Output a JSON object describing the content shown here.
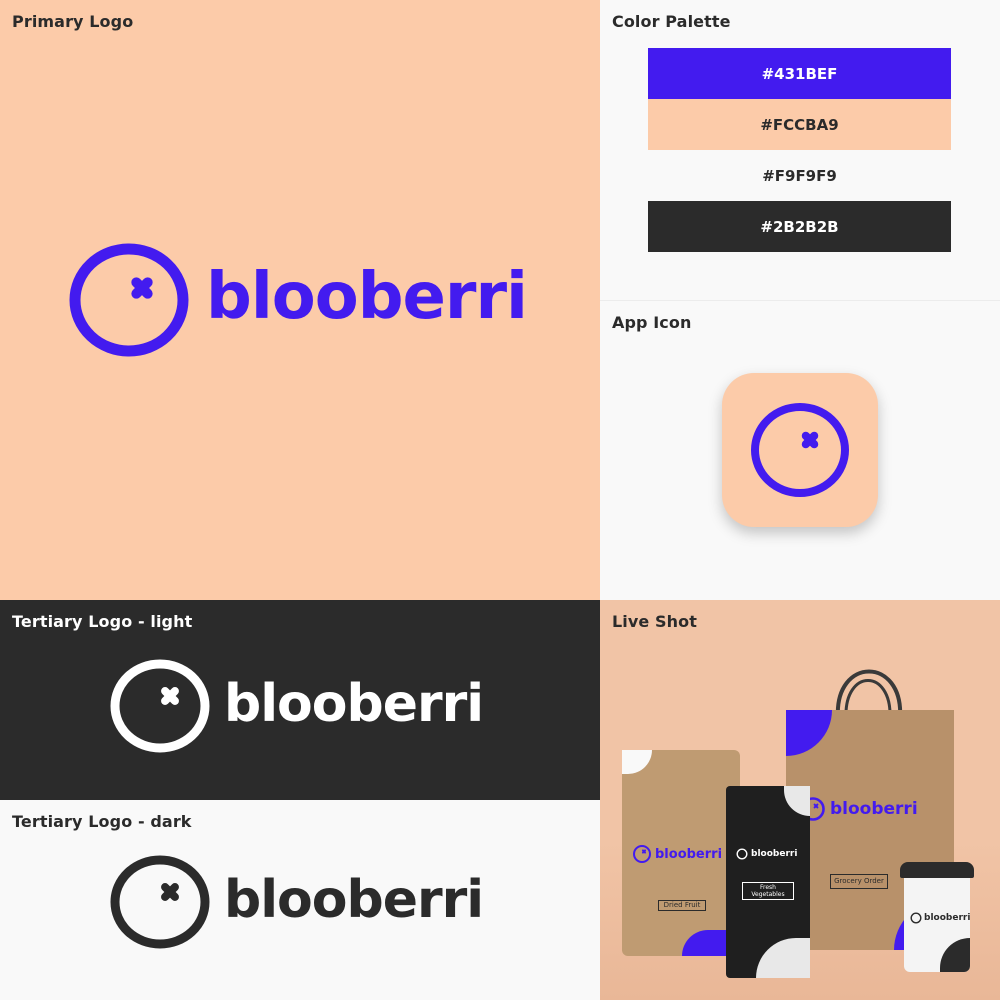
{
  "brand": {
    "name": "blooberri",
    "colors": {
      "primary": "#431BEF",
      "peach": "#FCCBA9",
      "light": "#F9F9F9",
      "dark": "#2B2B2B"
    }
  },
  "sections": {
    "primary_logo": "Primary Logo",
    "color_palette": "Color Palette",
    "app_icon": "App Icon",
    "tertiary_light": "Tertiary Logo - light",
    "tertiary_dark": "Tertiary Logo - dark",
    "live_shot": "Live Shot"
  },
  "palette": [
    {
      "hex": "#431BEF"
    },
    {
      "hex": "#FCCBA9"
    },
    {
      "hex": "#F9F9F9"
    },
    {
      "hex": "#2B2B2B"
    }
  ],
  "mockups": {
    "pouch_label": "Dried Fruit",
    "tall_bag_label": "Fresh Vegetables",
    "shopping_bag_label": "Grocery Order"
  },
  "icons": [
    "berry-logo-icon"
  ]
}
